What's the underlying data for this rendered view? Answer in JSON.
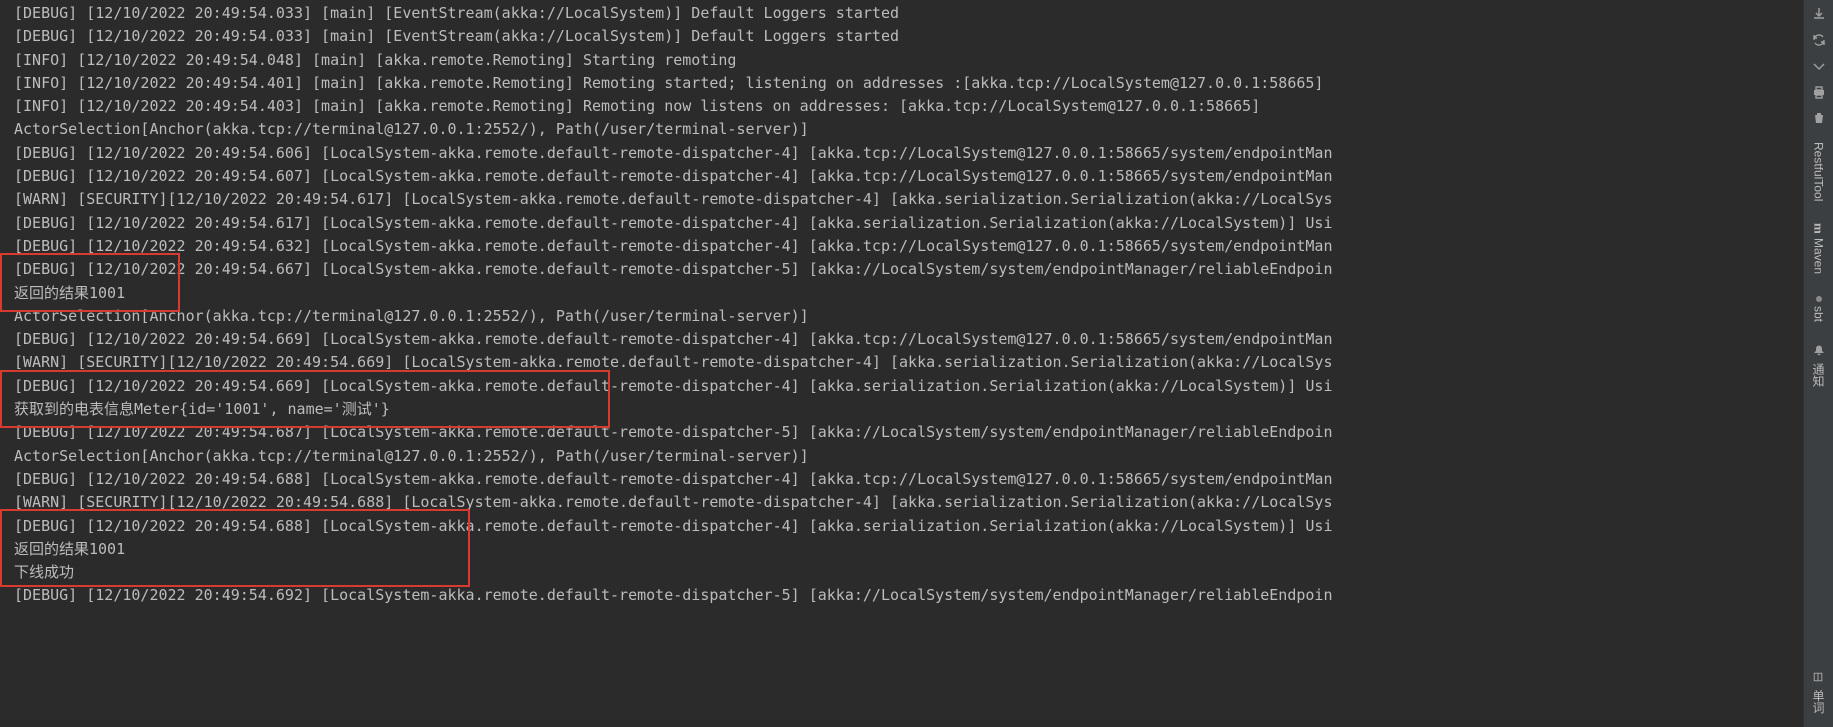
{
  "log_lines": [
    "[DEBUG] [12/10/2022 20:49:54.033] [main] [EventStream(akka://LocalSystem)] Default Loggers started",
    "[DEBUG] [12/10/2022 20:49:54.033] [main] [EventStream(akka://LocalSystem)] Default Loggers started",
    "[INFO] [12/10/2022 20:49:54.048] [main] [akka.remote.Remoting] Starting remoting",
    "[INFO] [12/10/2022 20:49:54.401] [main] [akka.remote.Remoting] Remoting started; listening on addresses :[akka.tcp://LocalSystem@127.0.0.1:58665]",
    "[INFO] [12/10/2022 20:49:54.403] [main] [akka.remote.Remoting] Remoting now listens on addresses: [akka.tcp://LocalSystem@127.0.0.1:58665]",
    "ActorSelection[Anchor(akka.tcp://terminal@127.0.0.1:2552/), Path(/user/terminal-server)]",
    "[DEBUG] [12/10/2022 20:49:54.606] [LocalSystem-akka.remote.default-remote-dispatcher-4] [akka.tcp://LocalSystem@127.0.0.1:58665/system/endpointMan",
    "[DEBUG] [12/10/2022 20:49:54.607] [LocalSystem-akka.remote.default-remote-dispatcher-4] [akka.tcp://LocalSystem@127.0.0.1:58665/system/endpointMan",
    "[WARN] [SECURITY][12/10/2022 20:49:54.617] [LocalSystem-akka.remote.default-remote-dispatcher-4] [akka.serialization.Serialization(akka://LocalSys",
    "[DEBUG] [12/10/2022 20:49:54.617] [LocalSystem-akka.remote.default-remote-dispatcher-4] [akka.serialization.Serialization(akka://LocalSystem)] Usi",
    "[DEBUG] [12/10/2022 20:49:54.632] [LocalSystem-akka.remote.default-remote-dispatcher-4] [akka.tcp://LocalSystem@127.0.0.1:58665/system/endpointMan",
    "[DEBUG] [12/10/2022 20:49:54.667] [LocalSystem-akka.remote.default-remote-dispatcher-5] [akka://LocalSystem/system/endpointManager/reliableEndpoin",
    "返回的结果1001",
    "ActorSelection[Anchor(akka.tcp://terminal@127.0.0.1:2552/), Path(/user/terminal-server)]",
    "[DEBUG] [12/10/2022 20:49:54.669] [LocalSystem-akka.remote.default-remote-dispatcher-4] [akka.tcp://LocalSystem@127.0.0.1:58665/system/endpointMan",
    "[WARN] [SECURITY][12/10/2022 20:49:54.669] [LocalSystem-akka.remote.default-remote-dispatcher-4] [akka.serialization.Serialization(akka://LocalSys",
    "[DEBUG] [12/10/2022 20:49:54.669] [LocalSystem-akka.remote.default-remote-dispatcher-4] [akka.serialization.Serialization(akka://LocalSystem)] Usi",
    "获取到的电表信息Meter{id='1001', name='测试'}",
    "[DEBUG] [12/10/2022 20:49:54.687] [LocalSystem-akka.remote.default-remote-dispatcher-5] [akka://LocalSystem/system/endpointManager/reliableEndpoin",
    "ActorSelection[Anchor(akka.tcp://terminal@127.0.0.1:2552/), Path(/user/terminal-server)]",
    "[DEBUG] [12/10/2022 20:49:54.688] [LocalSystem-akka.remote.default-remote-dispatcher-4] [akka.tcp://LocalSystem@127.0.0.1:58665/system/endpointMan",
    "[WARN] [SECURITY][12/10/2022 20:49:54.688] [LocalSystem-akka.remote.default-remote-dispatcher-4] [akka.serialization.Serialization(akka://LocalSys",
    "[DEBUG] [12/10/2022 20:49:54.688] [LocalSystem-akka.remote.default-remote-dispatcher-4] [akka.serialization.Serialization(akka://LocalSystem)] Usi",
    "返回的结果1001",
    "下线成功",
    "[DEBUG] [12/10/2022 20:49:54.692] [LocalSystem-akka.remote.default-remote-dispatcher-5] [akka://LocalSystem/system/endpointManager/reliableEndpoin"
  ],
  "right_tabs": {
    "restful": "RestfulTool",
    "maven": "Maven",
    "sbt": "sbt",
    "notify": "通知"
  },
  "bottom_tab": "单词"
}
